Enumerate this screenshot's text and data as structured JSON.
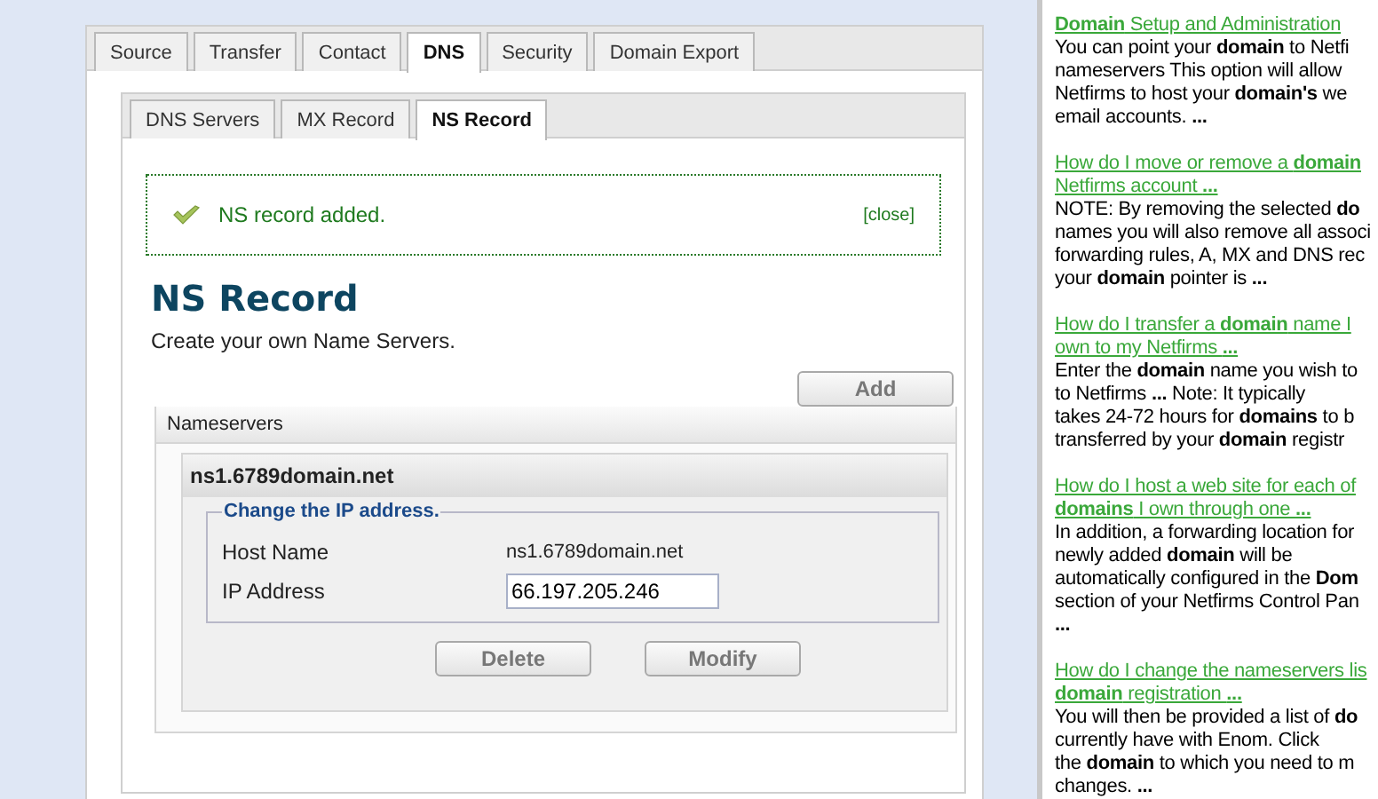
{
  "tabs": [
    {
      "label": "Source",
      "selected": false
    },
    {
      "label": "Transfer",
      "selected": false
    },
    {
      "label": "Contact",
      "selected": false
    },
    {
      "label": "DNS",
      "selected": true
    },
    {
      "label": "Security",
      "selected": false
    },
    {
      "label": "Domain Export",
      "selected": false
    }
  ],
  "subtabs": [
    {
      "label": "DNS Servers",
      "selected": false
    },
    {
      "label": "MX Record",
      "selected": false
    },
    {
      "label": "NS Record",
      "selected": true
    }
  ],
  "message": {
    "text": "NS record added.",
    "close": "[close]"
  },
  "heading": "NS Record",
  "subtitle": "Create your own Name Servers.",
  "add_button": "Add",
  "nameservers": {
    "title": "Nameservers",
    "records": [
      {
        "name": "ns1.6789domain.net",
        "legend": "Change the IP address.",
        "host_label": "Host Name",
        "host_value": "ns1.6789domain.net",
        "ip_label": "IP Address",
        "ip_value": "66.197.205.246",
        "buttons": [
          "Delete",
          "Modify"
        ]
      }
    ]
  },
  "results": [
    {
      "title_lines": [
        "**Domain** Setup and Administration"
      ],
      "body_lines": [
        "You can point your **domain** to Netfi",
        "nameservers This option will allow",
        "Netfirms to host your **domain's** we",
        "email accounts. **...**"
      ]
    },
    {
      "title_lines": [
        "How do I move or remove a **domain**",
        "Netfirms account **...**"
      ],
      "body_lines": [
        "NOTE: By removing the selected **do**",
        "names you will also remove all associ",
        "forwarding rules, A, MX and DNS rec",
        "your **domain** pointer is **...**"
      ]
    },
    {
      "title_lines": [
        "How do I transfer a **domain** name I",
        "own to my Netfirms **...**"
      ],
      "body_lines": [
        "Enter the **domain** name you wish to",
        "to Netfirms **...** Note: It typically",
        "takes 24-72 hours for **domains** to b",
        "transferred by your **domain** registr"
      ]
    },
    {
      "title_lines": [
        "How do I host a web site for each of",
        "**domains** I own through one **...**"
      ],
      "body_lines": [
        "In addition, a forwarding location for",
        "newly added **domain** will be",
        "automatically configured in the **Dom**",
        "section of your Netfirms Control Pan",
        "**...**"
      ]
    },
    {
      "title_lines": [
        "How do I change the nameservers lis",
        "**domain** registration **...**"
      ],
      "body_lines": [
        "You will then be provided a list of **do**",
        "currently have with Enom. Click",
        "the **domain** to which you need to m",
        "changes. **...**"
      ]
    }
  ]
}
